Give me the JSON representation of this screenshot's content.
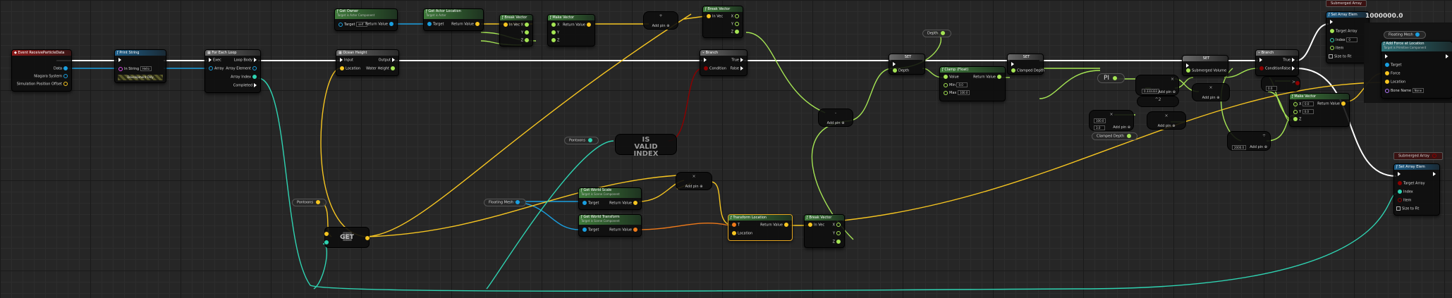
{
  "canvas": {
    "background": "#262626"
  },
  "colors": {
    "exec": "#ffffff",
    "object": "#1a9fe0",
    "vector": "#f6c521",
    "float": "#a5e554",
    "int": "#2fd3b2",
    "bool": "#8c0000",
    "transform": "#f07a1a",
    "struct": "#7a7aff"
  },
  "nodes": {
    "event_receive": {
      "title": "Event ReceiveParticleData",
      "pins": [
        "Data",
        "Niagara System",
        "Simulation Position Offset"
      ]
    },
    "print_string": {
      "title": "Print String",
      "pins": [
        "In String",
        "Hello"
      ],
      "extra": "Development Only"
    },
    "for_each": {
      "title": "For Each Loop",
      "pins": [
        "Exec",
        "Array",
        "Loop Body",
        "Array Element",
        "Array Index",
        "Completed"
      ]
    },
    "get_owner": {
      "title": "Get Owner",
      "subtitle": "Target is Actor Component",
      "pins": [
        "Target",
        "self",
        "Return Value"
      ]
    },
    "get_actor_location": {
      "title": "Get Actor Location",
      "subtitle": "Target is Actor",
      "pins": [
        "Target",
        "Return Value"
      ]
    },
    "break_vector1": {
      "title": "Break Vector",
      "pins": [
        "In Vec",
        "X",
        "Y",
        "Z"
      ]
    },
    "make_vector1": {
      "title": "Make Vector",
      "pins": [
        "X",
        "Y",
        "Z",
        "Return Value"
      ]
    },
    "add1": {
      "op": "+",
      "label": "Add pin"
    },
    "break_vector2": {
      "title": "Break Vector",
      "pins": [
        "In Vec",
        "X",
        "Y",
        "Z"
      ]
    },
    "ocean_height": {
      "title": "Ocean Height",
      "pins": [
        "Input",
        "Location",
        "Output",
        "Water Height"
      ]
    },
    "branch1": {
      "title": "Branch",
      "pins": [
        "Condition",
        "True",
        "False"
      ]
    },
    "pontoons1": {
      "label": "Pontoons"
    },
    "is_valid_index": {
      "text": "IS VALID INDEX"
    },
    "depth_var": {
      "label": "Depth"
    },
    "set_depth": {
      "title": "SET",
      "pins": [
        "Depth"
      ]
    },
    "clamp": {
      "title": "Clamp (Float)",
      "pins": [
        "Value",
        "Min",
        "0.0",
        "Max",
        "100.0",
        "Return Value"
      ]
    },
    "set_clamped": {
      "title": "SET",
      "pins": [
        "Clamped Depth"
      ]
    },
    "subtract1": {
      "op": "-",
      "label": "Add pin"
    },
    "pi": {
      "label": "PI"
    },
    "multiply1": {
      "op": "×",
      "label": "Add pin",
      "value": "0.333333"
    },
    "power": {
      "op": "^2"
    },
    "multiply2": {
      "op": "×",
      "label": "Add pin"
    },
    "multiply3": {
      "op": "×",
      "label": "Add pin",
      "values": [
        "100.0",
        "3.0"
      ]
    },
    "clamped_depth": {
      "label": "Clamped Depth"
    },
    "multiply4": {
      "op": "×",
      "label": "Add pin"
    },
    "set_submerged": {
      "title": "SET",
      "pins": [
        "Submerged Volume"
      ]
    },
    "branch2": {
      "title": "Branch",
      "pins": [
        "Condition",
        "True",
        "False"
      ]
    },
    "compare": {
      "op": ">",
      "value": "0.0"
    },
    "divide": {
      "op": "÷",
      "label": "Add pin",
      "value": "2000.0"
    },
    "make_vector2": {
      "title": "Make Vector",
      "pins": [
        "X",
        "0.0",
        "Y",
        "0.0",
        "Z",
        "Return Value"
      ]
    },
    "set_array_elem1": {
      "title": "Set Array Elem",
      "pins": [
        "Target Array",
        "Index",
        "0",
        "Item",
        "Size to Fit"
      ]
    },
    "add_force": {
      "title": "Add Force at Location",
      "subtitle": "Target is Primitive Component",
      "pins": [
        "Target",
        "Force",
        "Location",
        "Bone Name",
        "None"
      ]
    },
    "floating_mesh1": {
      "label": "Floating Mesh"
    },
    "submerged_array1": {
      "label": "Submerged Array"
    },
    "value_big": {
      "text": "1000000.0"
    },
    "submerged_array2": {
      "label": "Submerged Array"
    },
    "set_array_elem2": {
      "title": "Set Array Elem",
      "pins": [
        "Target Array",
        "Index",
        "Item",
        "Size to Fit"
      ]
    },
    "pontoons2": {
      "label": "Pontoons"
    },
    "get_node": {
      "text": "GET"
    },
    "floating_mesh2": {
      "label": "Floating Mesh"
    },
    "get_world_scale": {
      "title": "Get World Scale",
      "subtitle": "Target is Scene Component",
      "pins": [
        "Target",
        "Return Value"
      ]
    },
    "get_world_transform": {
      "title": "Get World Transform",
      "subtitle": "Target is Scene Component",
      "pins": [
        "Target",
        "Return Value"
      ]
    },
    "multiply5": {
      "op": "×",
      "label": "Add pin"
    },
    "transform_location": {
      "title": "Transform Location",
      "pins": [
        "T",
        "Location",
        "Return Value"
      ]
    },
    "break_vector3": {
      "title": "Break Vector",
      "pins": [
        "In Vec",
        "X",
        "Y",
        "Z"
      ]
    }
  }
}
